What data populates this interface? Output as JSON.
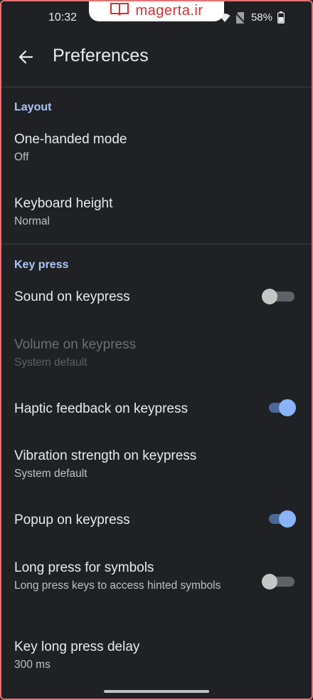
{
  "status_bar": {
    "time": "10:32",
    "battery": "58%"
  },
  "watermark": {
    "text": "magerta.ir"
  },
  "app_bar": {
    "title": "Preferences"
  },
  "sections": {
    "layout": {
      "header": "Layout",
      "one_handed": {
        "title": "One-handed mode",
        "summary": "Off"
      },
      "keyboard_height": {
        "title": "Keyboard height",
        "summary": "Normal"
      }
    },
    "key_press": {
      "header": "Key press",
      "sound": {
        "title": "Sound on keypress",
        "enabled": false
      },
      "volume": {
        "title": "Volume on keypress",
        "summary": "System default"
      },
      "haptic": {
        "title": "Haptic feedback on keypress",
        "enabled": true
      },
      "vibration": {
        "title": "Vibration strength on keypress",
        "summary": "System default"
      },
      "popup": {
        "title": "Popup on keypress",
        "enabled": true
      },
      "long_press_symbols": {
        "title": "Long press for symbols",
        "summary": "Long press keys to access hinted symbols",
        "enabled": false
      },
      "long_press_delay": {
        "title": "Key long press delay",
        "summary": "300 ms"
      }
    }
  },
  "colors": {
    "background": "#202124",
    "accent": "#8ab4f8",
    "section_header": "#a8c7fa",
    "frame": "#e57373"
  }
}
